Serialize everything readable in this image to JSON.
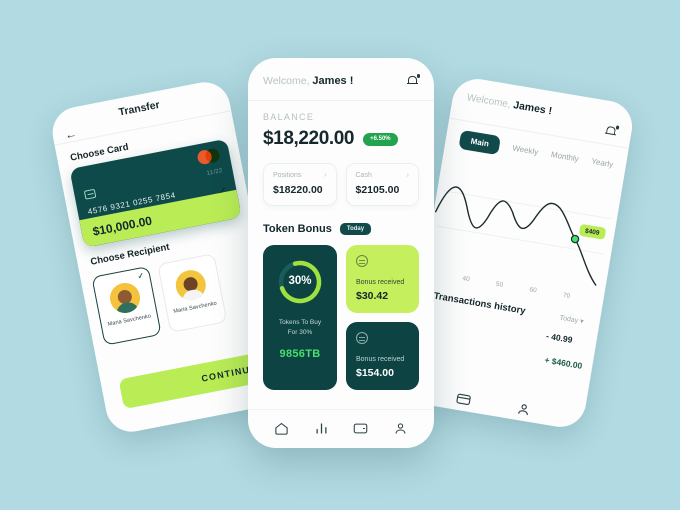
{
  "theme": {
    "background": "#b1dae2",
    "dark_teal": "#0e4344",
    "lime": "#c6ef5d",
    "bright_green": "#46e06a",
    "badge_green": "#22a44e",
    "card_teal": "#0f4a4a"
  },
  "left_phone": {
    "title": "Transfer",
    "back_icon": "arrow-left-icon",
    "choose_card_label": "Choose Card",
    "card": {
      "number": "4576 9321 0255 7854",
      "expiry": "11/22",
      "amount": "$10,000.00",
      "brand": "mastercard-logo",
      "chip_icon": "card-chip-icon",
      "selected_icon": "check-icon"
    },
    "choose_recipient_label": "Choose Recipient",
    "recipients": [
      {
        "name": "Maria Savchenko",
        "selected": true
      },
      {
        "name": "Maria Savchenko",
        "selected": false
      }
    ],
    "continue_label": "CONTINUE"
  },
  "center_phone": {
    "welcome_prefix": "Welcome,",
    "welcome_name": "James !",
    "bell_icon": "bell-notification-icon",
    "balance_label": "BALANCE",
    "balance_amount": "$18,220.00",
    "balance_change": "+6.50%",
    "mini_cards": [
      {
        "label": "Positions",
        "value": "$18220.00",
        "chevron": "chevron-right-icon"
      },
      {
        "label": "Cash",
        "value": "$2105.00",
        "chevron": "chevron-right-icon"
      }
    ],
    "token_bonus_title": "Token Bonus",
    "token_bonus_badge": "Today",
    "progress": {
      "percent_label": "30%",
      "percent_value": 30,
      "caption_line1": "Tokens To Buy",
      "caption_line2": "For 30%",
      "tokens": "9856TB"
    },
    "bonuses": [
      {
        "label": "Bonus received",
        "value": "$30.42",
        "style": "lime",
        "icon": "coin-icon"
      },
      {
        "label": "Bonus received",
        "value": "$154.00",
        "style": "dark",
        "icon": "coin-icon"
      }
    ],
    "nav": [
      {
        "icon": "home-icon",
        "active": true
      },
      {
        "icon": "bar-chart-icon",
        "active": false
      },
      {
        "icon": "card-icon",
        "active": false
      },
      {
        "icon": "profile-icon",
        "active": false
      }
    ]
  },
  "right_phone": {
    "welcome_prefix": "Welcome,",
    "welcome_name": "James !",
    "bell_icon": "bell-notification-icon",
    "tabs": [
      {
        "label": "Main",
        "active": true
      },
      {
        "label": "Weekly",
        "active": false
      },
      {
        "label": "Monthly",
        "active": false
      },
      {
        "label": "Yearly",
        "active": false
      }
    ],
    "chart_badge": "$409",
    "axis_labels": [
      "40",
      "50",
      "60",
      "70"
    ],
    "history_title": "Transactions history",
    "history_filter": "Today",
    "transactions": [
      {
        "amount": "- 40.99",
        "type": "debit"
      },
      {
        "amount": "+ $460.00",
        "type": "credit"
      }
    ],
    "nav": [
      {
        "icon": "card-icon"
      },
      {
        "icon": "profile-icon"
      }
    ]
  },
  "chart_data": {
    "type": "line",
    "title": "",
    "xlabel": "",
    "ylabel": "",
    "x": [
      40,
      45,
      50,
      55,
      60,
      65,
      70,
      75
    ],
    "x_ticks": [
      "40",
      "50",
      "60",
      "70"
    ],
    "values": [
      62,
      30,
      66,
      34,
      70,
      40,
      55,
      18
    ],
    "annotation": {
      "label": "$409",
      "at_x": 70,
      "at_y": 40
    },
    "grid": true,
    "legend": "none"
  }
}
